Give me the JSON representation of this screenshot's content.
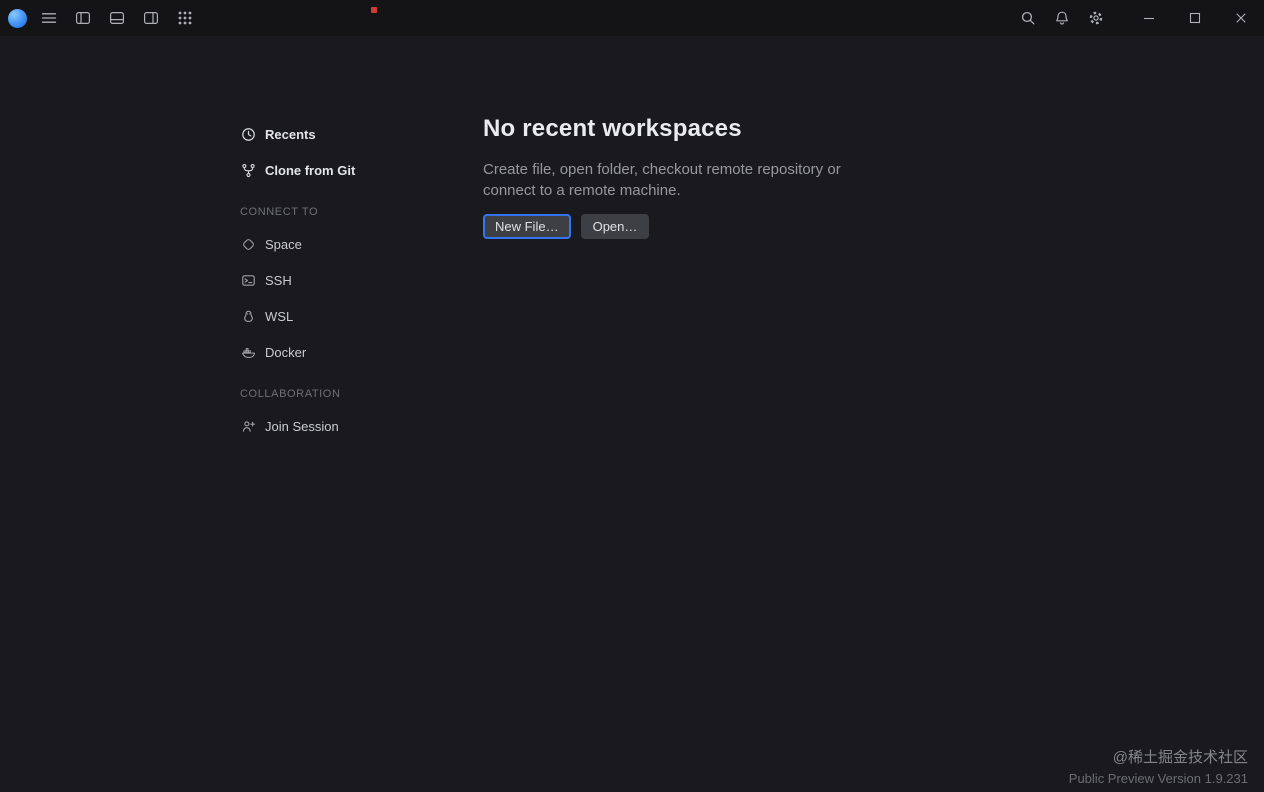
{
  "titlebar": {
    "left_icons": [
      "app-logo-icon",
      "menu-icon",
      "panel-left-icon",
      "panel-bottom-icon",
      "panel-right-icon",
      "apps-grid-icon"
    ],
    "right_icons": [
      "search-icon",
      "bell-icon",
      "gear-icon",
      "minimize-icon",
      "maximize-icon",
      "close-icon"
    ]
  },
  "sidebar": {
    "top_items": [
      {
        "label": "Recents",
        "icon": "clock-icon"
      },
      {
        "label": "Clone from Git",
        "icon": "git-fork-icon"
      }
    ],
    "sections": [
      {
        "header": "CONNECT TO",
        "items": [
          {
            "label": "Space",
            "icon": "space-logo-icon"
          },
          {
            "label": "SSH",
            "icon": "terminal-icon"
          },
          {
            "label": "WSL",
            "icon": "linux-penguin-icon"
          },
          {
            "label": "Docker",
            "icon": "docker-whale-icon"
          }
        ]
      },
      {
        "header": "COLLABORATION",
        "items": [
          {
            "label": "Join Session",
            "icon": "person-plus-icon"
          }
        ]
      }
    ]
  },
  "main": {
    "heading": "No recent workspaces",
    "description": "Create file, open folder, checkout remote repository or connect to a remote machine.",
    "buttons": [
      {
        "label": "New File…",
        "focused": true
      },
      {
        "label": "Open…",
        "focused": false
      }
    ]
  },
  "footer": {
    "watermark": "@稀土掘金技术社区",
    "version": "Public Preview Version 1.9.231"
  },
  "colors": {
    "accent": "#3574f0",
    "background": "#1a1a1e",
    "titlebar": "#141417",
    "button": "#3d3f44"
  }
}
